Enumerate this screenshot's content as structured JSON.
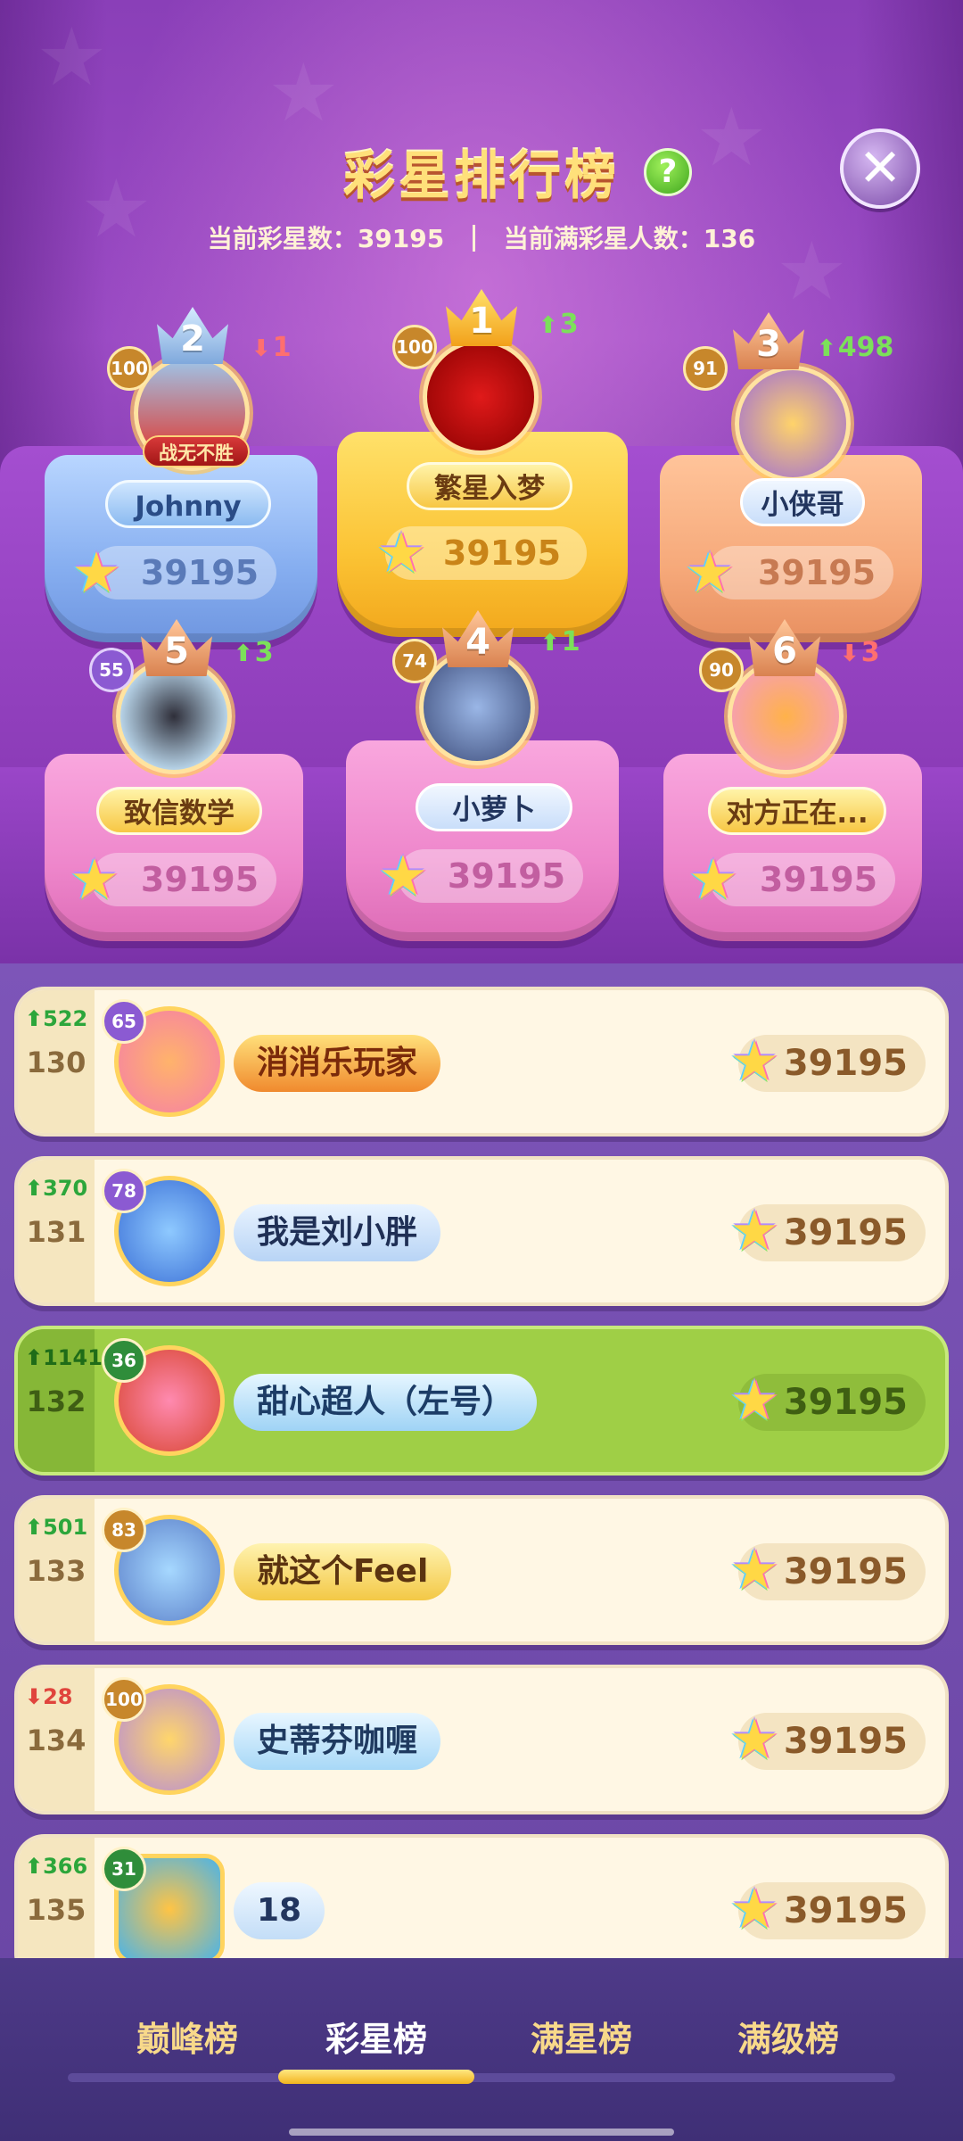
{
  "header": {
    "title": "彩星排行榜",
    "help_icon": "question-icon",
    "close_icon": "close-icon",
    "current_stars_label": "当前彩星数：",
    "current_stars_value": "39195",
    "full_star_label": "当前满彩星人数：",
    "full_star_value": "136"
  },
  "podium": [
    {
      "rank": "2",
      "name": "Johnny",
      "score": "39195",
      "level": "100",
      "change_dir": "down",
      "change": "1",
      "badge": "战无不胜"
    },
    {
      "rank": "1",
      "name": "繁星入梦",
      "score": "39195",
      "level": "100",
      "change_dir": "up",
      "change": "3"
    },
    {
      "rank": "3",
      "name": "小侠哥",
      "score": "39195",
      "level": "91",
      "change_dir": "up",
      "change": "498"
    },
    {
      "rank": "5",
      "name": "致信数学",
      "score": "39195",
      "level": "55",
      "change_dir": "up",
      "change": "3"
    },
    {
      "rank": "4",
      "name": "小萝卜",
      "score": "39195",
      "level": "74",
      "change_dir": "up",
      "change": "1"
    },
    {
      "rank": "6",
      "name": "对方正在...",
      "score": "39195",
      "level": "90",
      "change_dir": "down",
      "change": "3"
    }
  ],
  "list": [
    {
      "rank": "130",
      "change_dir": "up",
      "change": "522",
      "level": "65",
      "name": "消消乐玩家",
      "score": "39195",
      "highlight": false
    },
    {
      "rank": "131",
      "change_dir": "up",
      "change": "370",
      "level": "78",
      "name": "我是刘小胖",
      "score": "39195",
      "highlight": false
    },
    {
      "rank": "132",
      "change_dir": "up",
      "change": "1141",
      "level": "36",
      "name": "甜心超人（左号）",
      "score": "39195",
      "highlight": true
    },
    {
      "rank": "133",
      "change_dir": "up",
      "change": "501",
      "level": "83",
      "name": "就这个Feel",
      "score": "39195",
      "highlight": false
    },
    {
      "rank": "134",
      "change_dir": "down",
      "change": "28",
      "level": "100",
      "name": "史蒂芬咖喱",
      "score": "39195",
      "highlight": false
    },
    {
      "rank": "135",
      "change_dir": "up",
      "change": "366",
      "level": "31",
      "name": "18",
      "score": "39195",
      "highlight": false
    }
  ],
  "tabs": [
    {
      "label": "巅峰榜",
      "active": false
    },
    {
      "label": "彩星榜",
      "active": true
    },
    {
      "label": "满星榜",
      "active": false
    },
    {
      "label": "满级榜",
      "active": false
    }
  ],
  "colors": {
    "accent_gold": "#ffe07a",
    "up_green": "#2ca63b",
    "down_red": "#e0443c",
    "self_row": "#9fcf46"
  }
}
